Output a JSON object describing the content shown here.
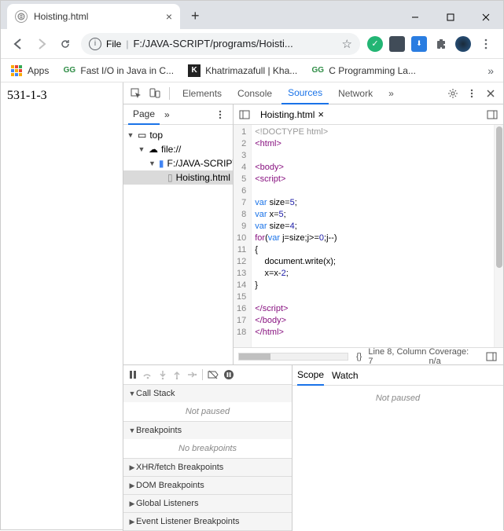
{
  "window": {
    "tab_title": "Hoisting.html",
    "newtab": "+"
  },
  "urlbar": {
    "scheme_label": "File",
    "path": "F:/JAVA-SCRIPT/programs/Hoisti..."
  },
  "bookmarks": {
    "apps": "Apps",
    "b1": "Fast I/O in Java in C...",
    "b2": "Khatrimazafull | Kha...",
    "b3": "C Programming La..."
  },
  "page_output": "531-1-3",
  "devtools": {
    "tabs": {
      "elements": "Elements",
      "console": "Console",
      "sources": "Sources",
      "network": "Network"
    },
    "page_tab": "Page",
    "tree": {
      "top": "top",
      "file": "file://",
      "folder": "F:/JAVA-SCRIPT/pro",
      "leaf": "Hoisting.html"
    },
    "editor_tab": "Hoisting.html",
    "code_lines": {
      "l1": "<!DOCTYPE html>",
      "l2": "<html>",
      "l3": "",
      "l4": "<body>",
      "l5": "<script>",
      "l6": "",
      "l7_a": "var",
      "l7_b": " size",
      "l7_c": "=",
      "l7_d": "5",
      "l7_e": ";",
      "l8_a": "var",
      "l8_b": " x",
      "l8_c": "=",
      "l8_d": "5",
      "l8_e": ";",
      "l9_a": "var",
      "l9_b": " size",
      "l9_c": "=",
      "l9_d": "4",
      "l9_e": ";",
      "l10_a": "for",
      "l10_b": "(",
      "l10_c": "var",
      "l10_d": " j",
      "l10_e": "=",
      "l10_f": "size;j",
      "l10_g": ">=",
      "l10_h": "0",
      "l10_i": ";j",
      "l10_j": "--",
      "l10_k": ")",
      "l11": "{",
      "l12": "    document.write(x);",
      "l13_a": "    x",
      "l13_b": "=",
      "l13_c": "x",
      "l13_d": "-",
      "l13_e": "2",
      "l13_f": ";",
      "l14": "}",
      "l15": "",
      "l16": "</script>",
      "l17": "</body>",
      "l18": "</html>"
    },
    "gutter": [
      "1",
      "2",
      "3",
      "4",
      "5",
      "6",
      "7",
      "8",
      "9",
      "10",
      "11",
      "12",
      "13",
      "14",
      "15",
      "16",
      "17",
      "18"
    ],
    "status": {
      "pos": "Line 8, Column 7",
      "coverage": "Coverage: n/a"
    },
    "debugger": {
      "callstack": "Call Stack",
      "not_paused": "Not paused",
      "breakpoints": "Breakpoints",
      "no_breakpoints": "No breakpoints",
      "xhr": "XHR/fetch Breakpoints",
      "dom": "DOM Breakpoints",
      "global": "Global Listeners",
      "event": "Event Listener Breakpoints",
      "scope": "Scope",
      "watch": "Watch",
      "scope_body": "Not paused"
    }
  },
  "chart_data": null
}
